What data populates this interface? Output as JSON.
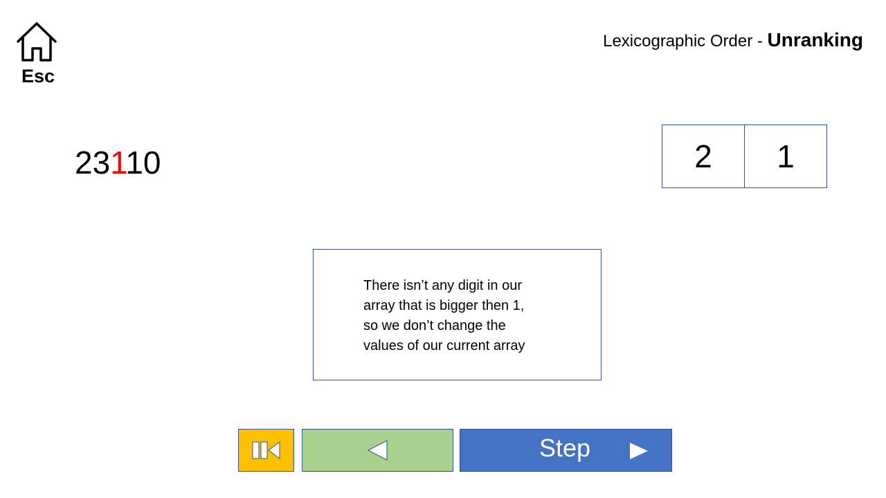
{
  "nav": {
    "esc_label": "Esc",
    "home_icon": "home-icon"
  },
  "header": {
    "title_prefix": "Lexicographic Order - ",
    "title_bold": "Unranking"
  },
  "number": {
    "before": "23",
    "highlight": "1",
    "after": "10",
    "highlight_color": "#ff0000"
  },
  "array": {
    "cells": [
      "2",
      "1"
    ]
  },
  "explanation": {
    "lines": [
      "There isn’t any digit in our",
      "array that is bigger then 1,",
      "so we don’t change the",
      "values of our current array"
    ]
  },
  "controls": {
    "reset_icon": "skip-to-start-icon",
    "back_icon": "triangle-left-icon",
    "step_label": "Step",
    "step_icon": "triangle-right-icon",
    "colors": {
      "reset": "#ffc000",
      "back": "#a9d18e",
      "step": "#4472c4"
    }
  }
}
